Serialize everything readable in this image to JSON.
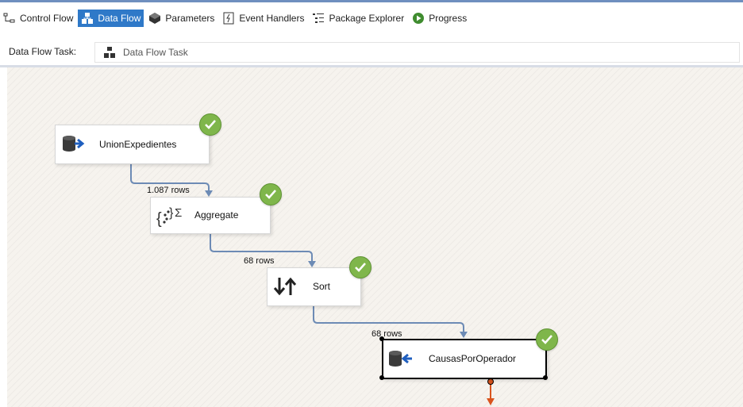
{
  "tabs": [
    {
      "label": "Control Flow",
      "icon": "control-flow-icon",
      "active": false
    },
    {
      "label": "Data Flow",
      "icon": "data-flow-icon",
      "active": true
    },
    {
      "label": "Parameters",
      "icon": "parameters-icon",
      "active": false
    },
    {
      "label": "Event Handlers",
      "icon": "event-handlers-icon",
      "active": false
    },
    {
      "label": "Package Explorer",
      "icon": "package-explorer-icon",
      "active": false
    },
    {
      "label": "Progress",
      "icon": "progress-icon",
      "active": false
    }
  ],
  "task_bar": {
    "label": "Data Flow Task:",
    "value": "Data Flow Task",
    "icon": "data-flow-task-icon"
  },
  "components": [
    {
      "label": "UnionExpedientes",
      "icon": "ole-db-source-icon",
      "status": "success"
    },
    {
      "label": "Aggregate",
      "icon": "aggregate-icon",
      "status": "success"
    },
    {
      "label": "Sort",
      "icon": "sort-icon",
      "status": "success"
    },
    {
      "label": "CausasPorOperador",
      "icon": "ole-db-destination-icon",
      "status": "success",
      "selected": true
    }
  ],
  "paths": [
    {
      "rows_label": "1.087 rows"
    },
    {
      "rows_label": "68 rows"
    },
    {
      "rows_label": "68 rows"
    }
  ],
  "colors": {
    "accent": "#2f79c8",
    "path": "#6d8bb5",
    "success": "#7fb64b",
    "error_output": "#d9541e"
  }
}
